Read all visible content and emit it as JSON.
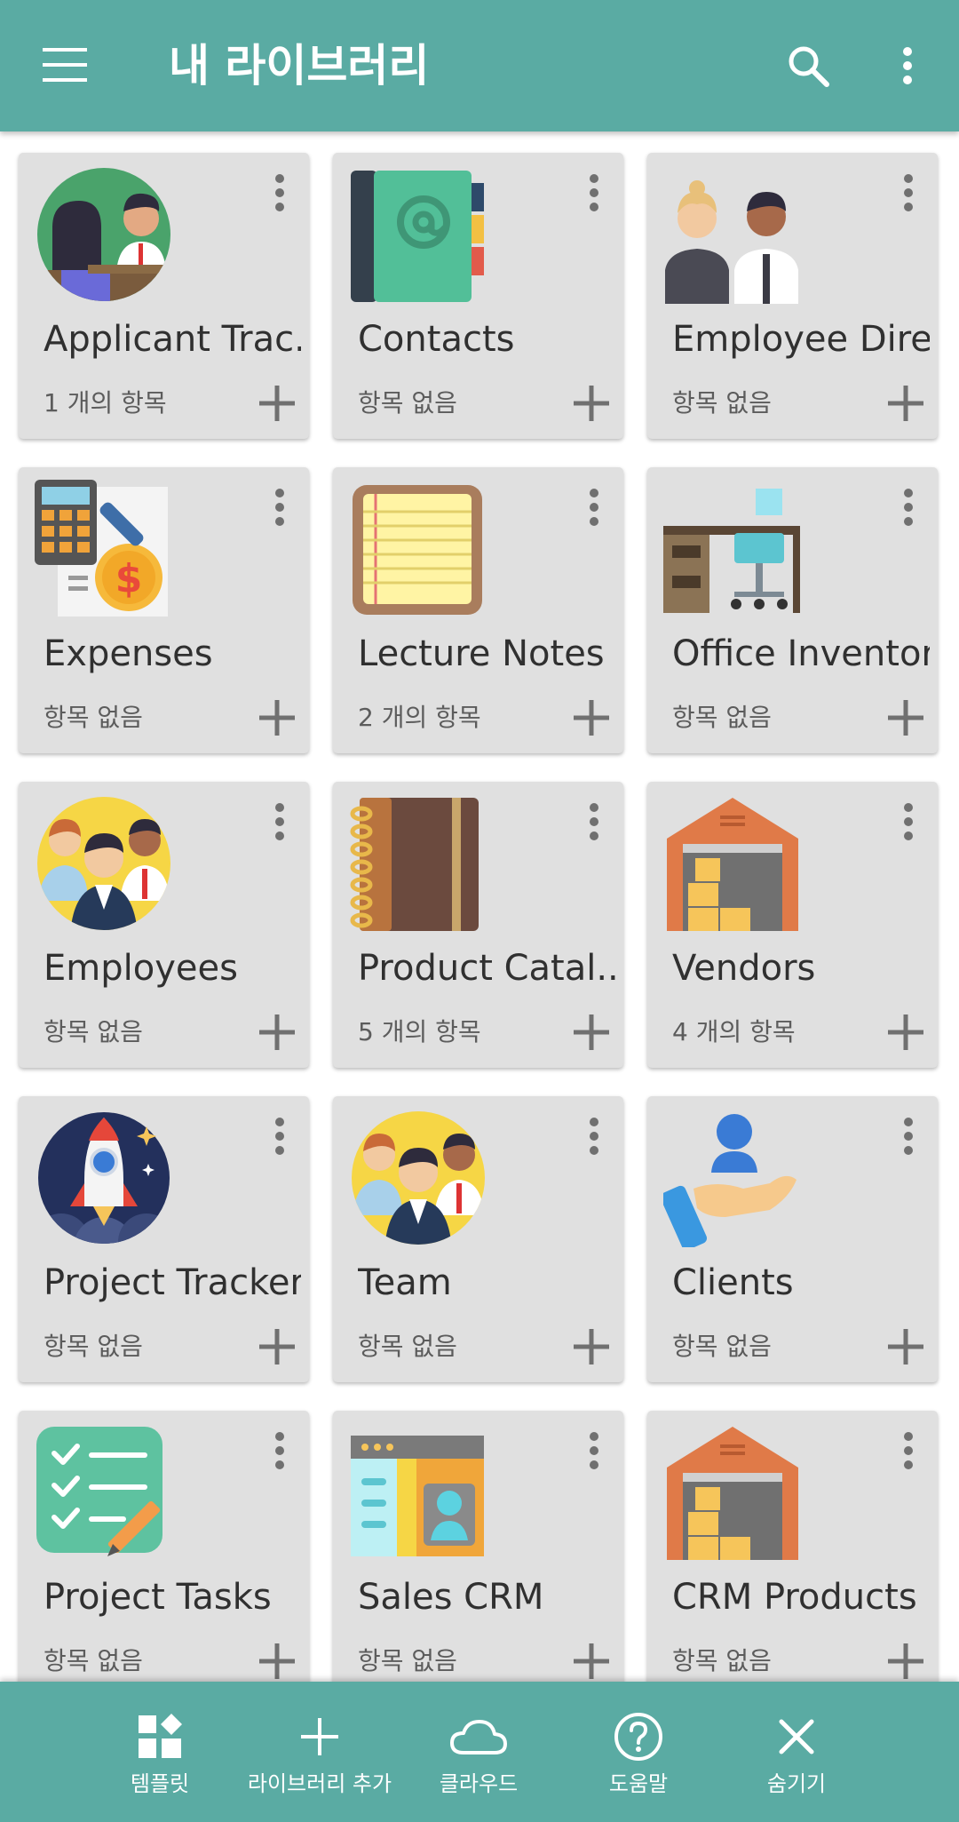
{
  "app_bar": {
    "title": "내 라이브러리",
    "menu_icon": "menu-icon",
    "search_icon": "search-icon",
    "more_icon": "more-vert-icon"
  },
  "libraries": [
    {
      "title": "Applicant Trac..",
      "count": "1 개의 항목",
      "icon": "interview-icon"
    },
    {
      "title": "Contacts",
      "count": "항목 없음",
      "icon": "address-book-icon"
    },
    {
      "title": "Employee Dire..",
      "count": "항목 없음",
      "icon": "employees-pair-icon"
    },
    {
      "title": "Expenses",
      "count": "항목 없음",
      "icon": "calculator-dollar-icon"
    },
    {
      "title": "Lecture Notes",
      "count": "2 개의 항목",
      "icon": "notepad-icon"
    },
    {
      "title": "Office Inventor..",
      "count": "항목 없음",
      "icon": "office-desk-icon"
    },
    {
      "title": "Employees",
      "count": "항목 없음",
      "icon": "people-group-icon"
    },
    {
      "title": "Product Catal..",
      "count": "5 개의 항목",
      "icon": "catalog-book-icon"
    },
    {
      "title": "Vendors",
      "count": "4 개의 항목",
      "icon": "warehouse-icon"
    },
    {
      "title": "Project Tracker",
      "count": "항목 없음",
      "icon": "rocket-icon"
    },
    {
      "title": "Team",
      "count": "항목 없음",
      "icon": "team-icon"
    },
    {
      "title": "Clients",
      "count": "항목 없음",
      "icon": "client-hand-icon"
    },
    {
      "title": "Project Tasks",
      "count": "항목 없음",
      "icon": "checklist-icon"
    },
    {
      "title": "Sales CRM",
      "count": "항목 없음",
      "icon": "contact-card-icon"
    },
    {
      "title": "CRM Products",
      "count": "항목 없음",
      "icon": "warehouse-icon"
    }
  ],
  "bottom_bar": [
    {
      "label": "템플릿",
      "icon": "templates-icon"
    },
    {
      "label": "라이브러리 추가",
      "icon": "plus-icon"
    },
    {
      "label": "클라우드",
      "icon": "cloud-icon"
    },
    {
      "label": "도움말",
      "icon": "help-icon"
    },
    {
      "label": "숨기기",
      "icon": "close-icon"
    }
  ],
  "colors": {
    "primary": "#5aaba3",
    "card_background": "#e0e0e0",
    "card_title": "#303030",
    "card_subtitle": "#5c5c5c",
    "card_icon_gray": "#707070"
  }
}
